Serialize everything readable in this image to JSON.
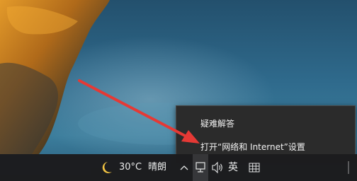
{
  "context_menu": {
    "items": [
      {
        "label": "疑难解答"
      },
      {
        "label": "打开“网络和 Internet”设置"
      }
    ]
  },
  "taskbar": {
    "weather": {
      "icon": "moon-icon",
      "temperature": "30°C",
      "condition": "晴朗"
    },
    "tray": {
      "chevron_icon": "chevron-up-icon",
      "network_icon": "network-icon",
      "volume_icon": "volume-icon",
      "input_method": "英",
      "ime_icon": "keyboard-grid-icon"
    }
  },
  "colors": {
    "menu_background": "#2b2b2b",
    "menu_text": "#f2f2f2",
    "taskbar_background": "#1c1c1e",
    "annotation_arrow": "#e53935",
    "moon": "#f5c542"
  }
}
